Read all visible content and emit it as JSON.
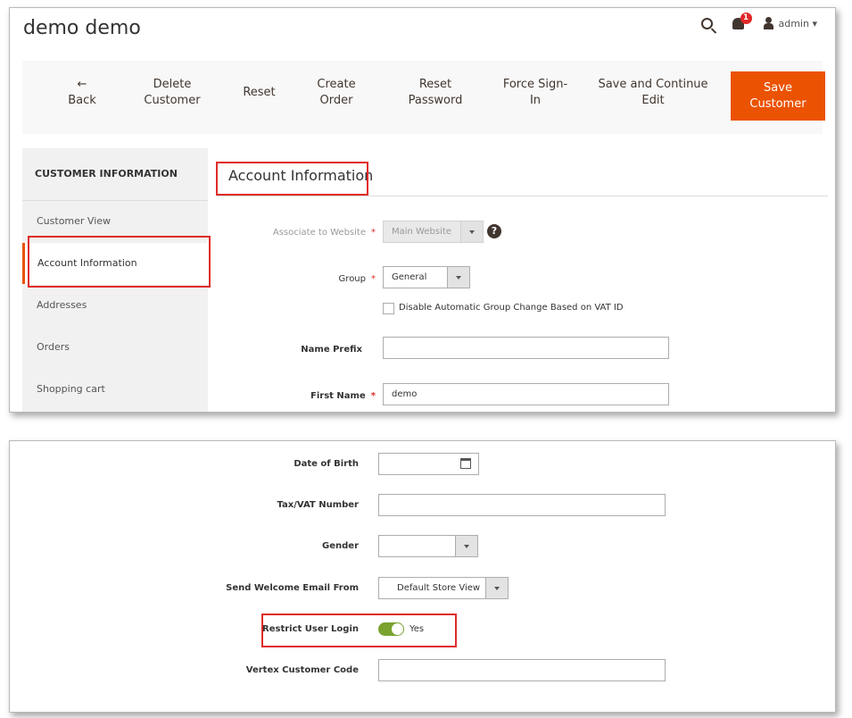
{
  "header": {
    "title": "demo demo",
    "notifications_count": "1",
    "user_label": "admin ▾"
  },
  "toolbar": {
    "back": "←\nBack",
    "delete": "Delete\nCustomer",
    "reset": "Reset",
    "create_order": "Create\nOrder",
    "reset_password": "Reset\nPassword",
    "force_signin": "Force Sign-\nIn",
    "save_continue": "Save and Continue\nEdit",
    "save": "Save\nCustomer",
    "accent_color": "#eb5202"
  },
  "sidebar": {
    "heading": "CUSTOMER INFORMATION",
    "items": [
      {
        "label": "Customer View"
      },
      {
        "label": "Account Information"
      },
      {
        "label": "Addresses"
      },
      {
        "label": "Orders"
      },
      {
        "label": "Shopping cart"
      }
    ]
  },
  "section": {
    "title": "Account Information"
  },
  "form": {
    "website_label": "Associate to Website",
    "website_value": "Main Website",
    "group_label": "Group",
    "group_value": "General",
    "disable_group_change_label": "Disable Automatic Group Change Based on VAT ID",
    "name_prefix_label": "Name Prefix",
    "name_prefix_value": "",
    "first_name_label": "First Name",
    "first_name_value": "demo",
    "dob_label": "Date of Birth",
    "dob_value": "",
    "taxvat_label": "Tax/VAT Number",
    "taxvat_value": "",
    "gender_label": "Gender",
    "gender_value": "",
    "welcome_label": "Send Welcome Email From",
    "welcome_value": "Default Store View",
    "restrict_label": "Restrict User Login",
    "restrict_value": "Yes",
    "vertex_label": "Vertex Customer Code",
    "vertex_value": "",
    "required_mark": "*"
  }
}
